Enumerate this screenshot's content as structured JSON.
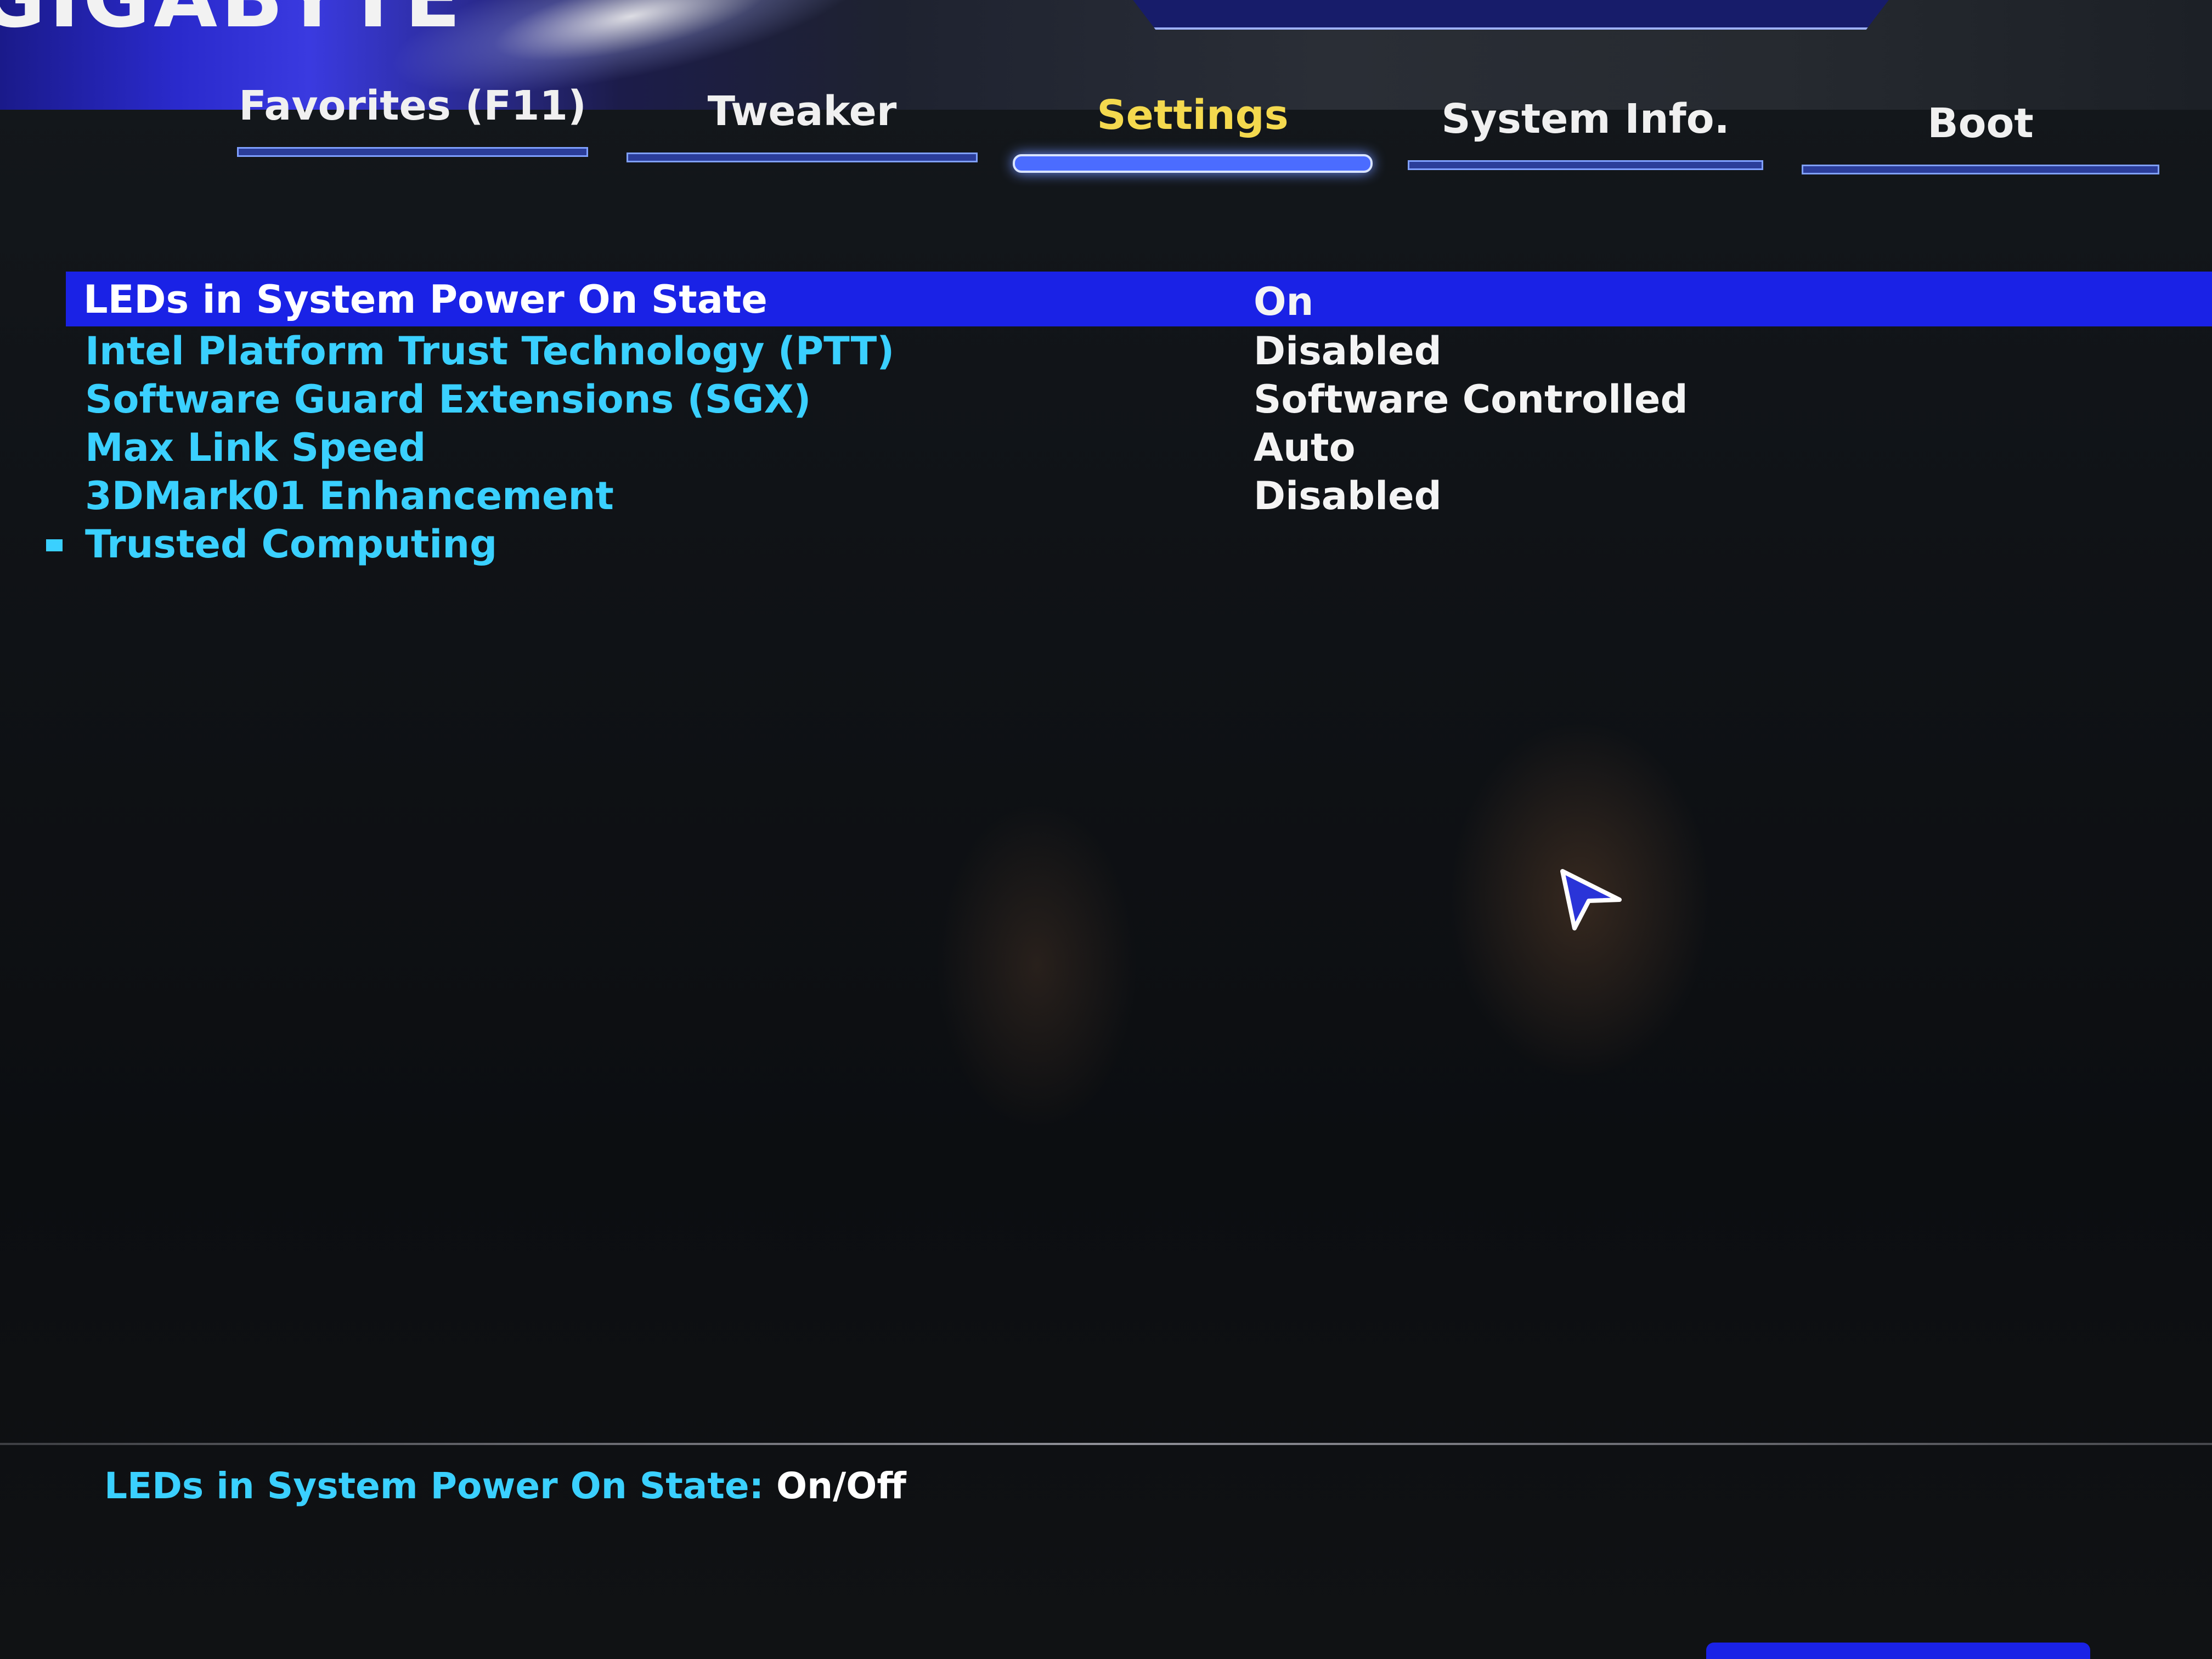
{
  "brand": {
    "logo_text": "GIGABYTE"
  },
  "tabs": [
    {
      "label": "Favorites (F11)",
      "active": false
    },
    {
      "label": "Tweaker",
      "active": false
    },
    {
      "label": "Settings",
      "active": true
    },
    {
      "label": "System Info.",
      "active": false
    },
    {
      "label": "Boot",
      "active": false
    }
  ],
  "settings": {
    "items": [
      {
        "name": "LEDs in System Power On State",
        "value": "On",
        "selected": true
      },
      {
        "name": "Intel Platform Trust Technology (PTT)",
        "value": "Disabled"
      },
      {
        "name": "Software Guard Extensions (SGX)",
        "value": "Software Controlled"
      },
      {
        "name": "Max Link Speed",
        "value": "Auto"
      },
      {
        "name": "3DMark01 Enhancement",
        "value": "Disabled"
      },
      {
        "name": "Trusted Computing",
        "value": "",
        "submenu": true
      }
    ]
  },
  "help": {
    "label": "LEDs in System Power On State:",
    "value": "On/Off"
  },
  "colors": {
    "selection_bar": "#1a22e6",
    "item_text": "#3ad0ff",
    "active_tab_text": "#f4d94e",
    "value_text": "#f4f4f4"
  },
  "icons": {
    "pointer": "mouse-cursor-icon",
    "submenu": "submenu-bullet-icon"
  }
}
